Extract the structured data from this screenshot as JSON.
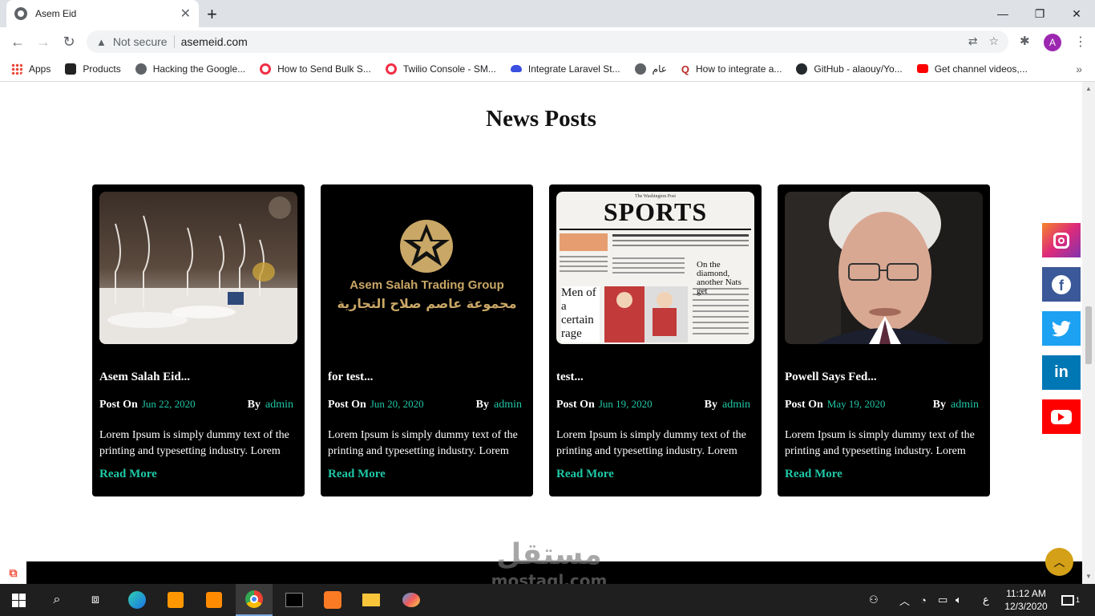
{
  "browser": {
    "tab_title": "Asem Eid",
    "url_security": "Not secure",
    "url": "asemeid.com",
    "profile_initial": "A",
    "bookmarks": [
      {
        "label": "Apps",
        "color": "#ea4335"
      },
      {
        "label": "Products",
        "color": "#222222"
      },
      {
        "label": "Hacking the Google...",
        "color": "#5f6368"
      },
      {
        "label": "How to Send Bulk S...",
        "color": "#f22f46"
      },
      {
        "label": "Twilio Console - SM...",
        "color": "#f22f46"
      },
      {
        "label": "Integrate Laravel St...",
        "color": "#3b4fe0"
      },
      {
        "label": "عام",
        "color": "#5f6368"
      },
      {
        "label": "How to integrate a...",
        "color": "#b92b27"
      },
      {
        "label": "GitHub - alaouy/Yo...",
        "color": "#24292e"
      },
      {
        "label": "Get channel videos,...",
        "color": "#ff0000"
      }
    ]
  },
  "page": {
    "section_title": "News Posts",
    "post_on_label": "Post On",
    "by_label": "By",
    "read_more_label": "Read More",
    "posts": [
      {
        "title": "Asem Salah Eid...",
        "date": "Jun 22, 2020",
        "author": "admin",
        "excerpt": "Lorem Ipsum is simply dummy text of the printing and typesetting industry. Lorem",
        "image": "glasses-table"
      },
      {
        "title": "for test...",
        "date": "Jun 20, 2020",
        "author": "admin",
        "excerpt": "Lorem Ipsum is simply dummy text of the printing and typesetting industry. Lorem",
        "image": "logo",
        "logo_text": "Asem Salah Trading Group",
        "logo_arabic": "مجموعة عاصم صلاح التجارية"
      },
      {
        "title": "test...",
        "date": "Jun 19, 2020",
        "author": "admin",
        "excerpt": "Lorem Ipsum is simply dummy text of the printing and typesetting industry. Lorem",
        "image": "newspaper",
        "paper_masthead": "The Washington Post",
        "paper_title": "SPORTS",
        "paper_headline1": "On the diamond,",
        "paper_headline2": "another Nats get",
        "paper_side": "Men of a certain rage"
      },
      {
        "title": "Powell Says Fed...",
        "date": "May 19, 2020",
        "author": "admin",
        "excerpt": "Lorem Ipsum is simply dummy text of the printing and typesetting industry. Lorem",
        "image": "portrait"
      }
    ],
    "social": [
      {
        "name": "instagram",
        "color": "#e1306c"
      },
      {
        "name": "facebook",
        "color": "#3b5998"
      },
      {
        "name": "twitter",
        "color": "#1da1f2"
      },
      {
        "name": "linkedin",
        "color": "#0077b5"
      },
      {
        "name": "youtube",
        "color": "#ff0000"
      }
    ],
    "accent_color": "#1fc8a6"
  },
  "watermark": {
    "arabic": "مستقل",
    "latin": "mostaql.com"
  },
  "taskbar": {
    "time": "11:12 AM",
    "date": "12/3/2020",
    "lang": "ع",
    "notifications": "1"
  }
}
